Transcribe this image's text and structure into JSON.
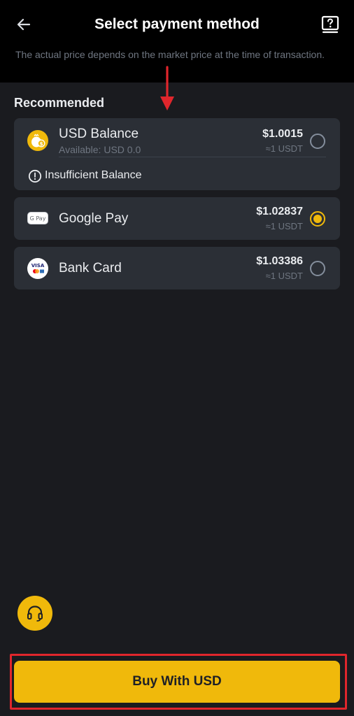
{
  "header": {
    "title": "Select payment method",
    "notice": "The actual price depends on the market price at the time of transaction."
  },
  "section": {
    "title": "Recommended"
  },
  "methods": [
    {
      "name": "USD Balance",
      "sub": "Available: USD 0.0",
      "price": "$1.0015",
      "approx": "≈1 USDT",
      "selected": false,
      "warning": "Insufficient Balance",
      "icon": "money-bag-icon"
    },
    {
      "name": "Google Pay",
      "price": "$1.02837",
      "approx": "≈1 USDT",
      "selected": true,
      "icon": "google-pay-icon",
      "icon_text": "G Pay"
    },
    {
      "name": "Bank Card",
      "price": "$1.03386",
      "approx": "≈1 USDT",
      "selected": false,
      "icon": "bank-card-icon",
      "icon_text": "VISA"
    }
  ],
  "buy_button": {
    "label": "Buy With USD"
  },
  "colors": {
    "accent": "#f0b90b",
    "background": "#1a1b1f",
    "card": "#2b2f36",
    "annotation": "#e0262c"
  }
}
